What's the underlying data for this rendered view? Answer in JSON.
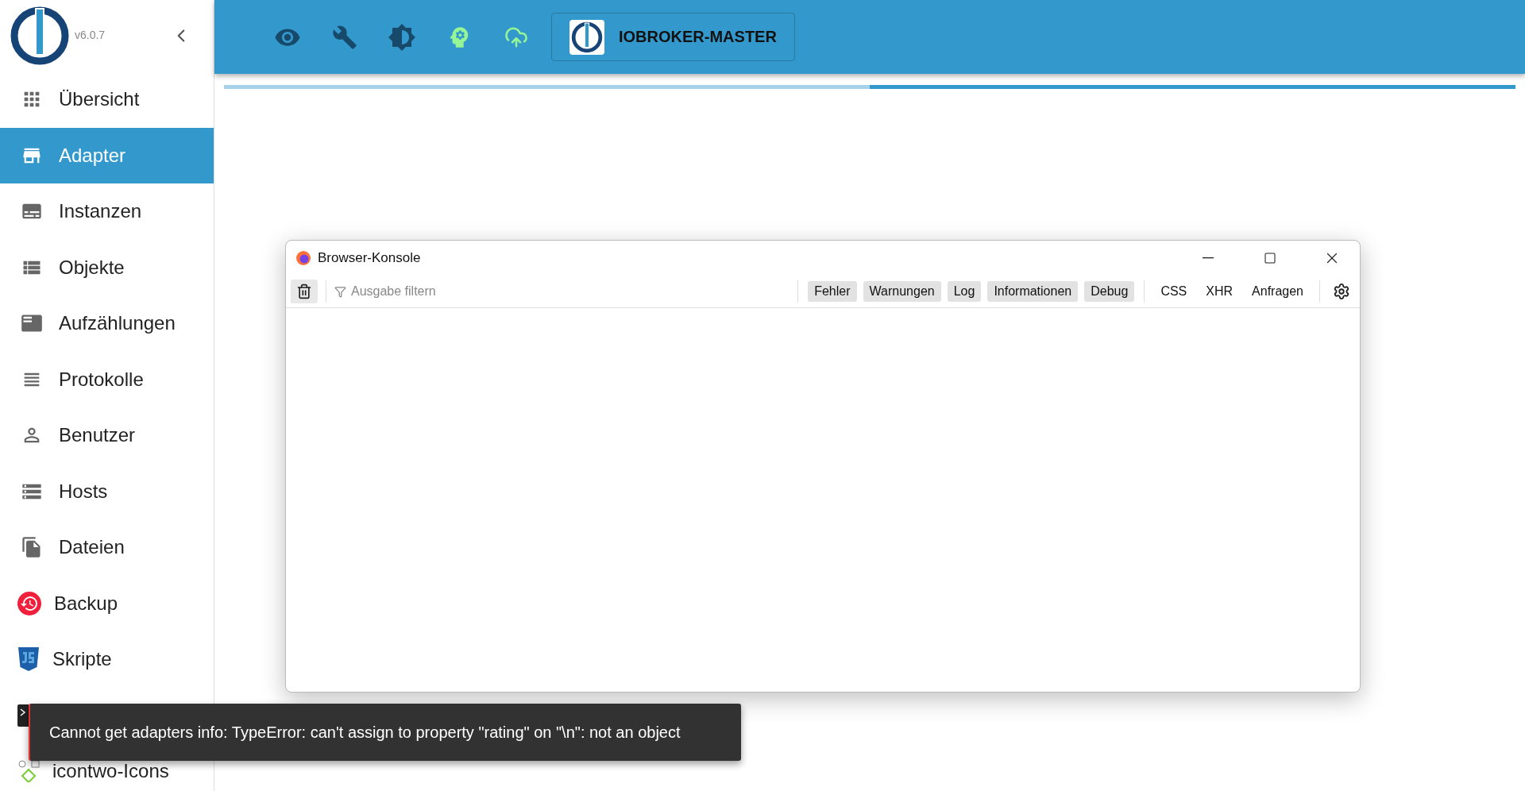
{
  "sidebar": {
    "version": "v6.0.7",
    "items": [
      {
        "label": "Übersicht",
        "selected": false
      },
      {
        "label": "Adapter",
        "selected": true
      },
      {
        "label": "Instanzen",
        "selected": false
      },
      {
        "label": "Objekte",
        "selected": false
      },
      {
        "label": "Aufzählungen",
        "selected": false
      },
      {
        "label": "Protokolle",
        "selected": false
      },
      {
        "label": "Benutzer",
        "selected": false
      },
      {
        "label": "Hosts",
        "selected": false
      },
      {
        "label": "Dateien",
        "selected": false
      },
      {
        "label": "Backup",
        "selected": false
      },
      {
        "label": "Skripte",
        "selected": false
      },
      {
        "selected": false
      },
      {
        "label": "icontwo-Icons",
        "selected": false
      }
    ]
  },
  "toolbar": {
    "host": "IOBROKER-MASTER",
    "progress": {
      "level": 0.5
    }
  },
  "console": {
    "title": "Browser-Konsole",
    "filter_placeholder": "Ausgabe filtern",
    "levels": [
      {
        "label": "Fehler",
        "selected": true
      },
      {
        "label": "Warnungen",
        "selected": true
      },
      {
        "label": "Log",
        "selected": true
      },
      {
        "label": "Informationen",
        "selected": true
      },
      {
        "label": "Debug",
        "selected": true
      }
    ],
    "types": [
      {
        "label": "CSS",
        "selected": false
      },
      {
        "label": "XHR",
        "selected": false
      },
      {
        "label": "Anfragen",
        "selected": false
      }
    ]
  },
  "toast": {
    "message": "Cannot get adapters info: TypeError: can't assign to property \"rating\" on \"\\n\": not an object"
  }
}
